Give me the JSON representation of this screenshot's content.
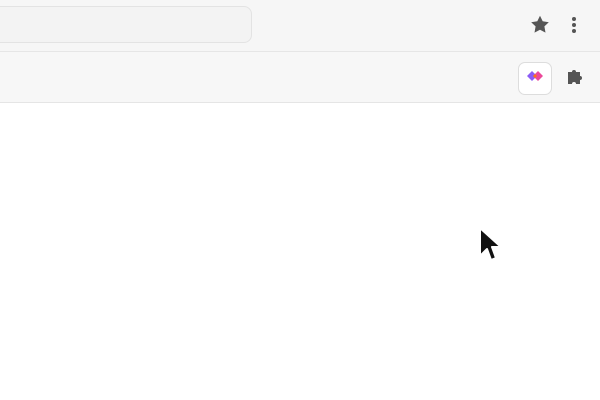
{
  "browser": {
    "toolbar": {
      "address_bar_value": "",
      "star_icon": "star-icon",
      "menu_icon": "more-vertical-icon"
    },
    "extensions_bar": {
      "extension_icon": "colorful-heart-extension-icon",
      "extensions_menu_icon": "puzzle-icon"
    },
    "page": {
      "content": ""
    }
  }
}
